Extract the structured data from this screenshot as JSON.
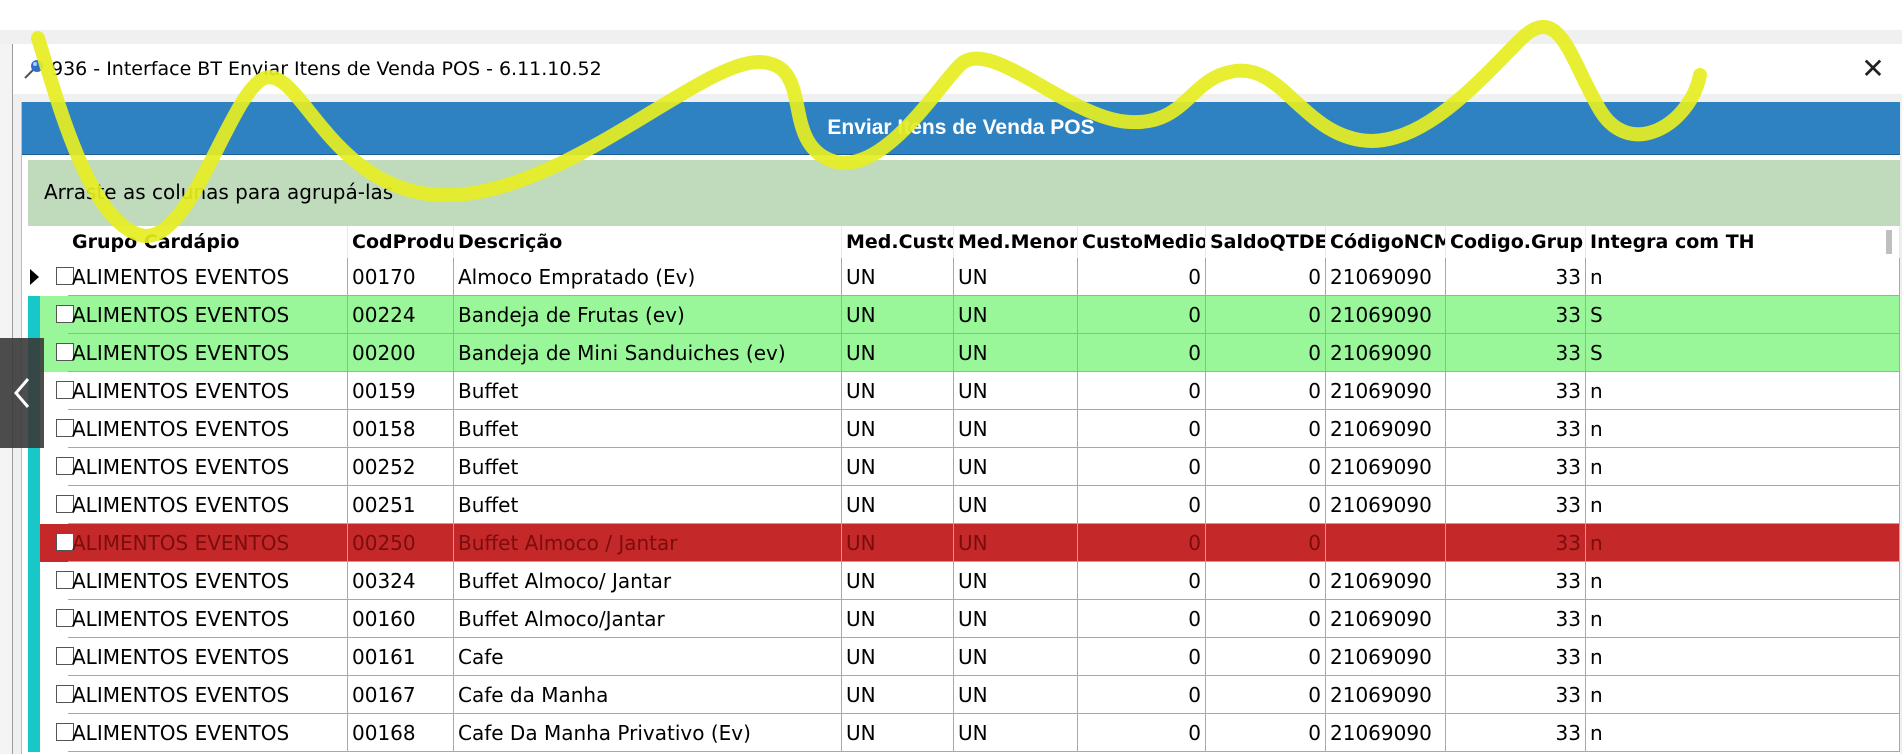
{
  "window": {
    "title": "936 - Interface BT Enviar Itens de Venda POS - 6.11.10.52",
    "close_glyph": "✕"
  },
  "header": {
    "title": "Enviar Itens de Venda POS"
  },
  "group_area": {
    "hint": "Arraste as colunas para agrupá-las"
  },
  "columns": [
    "Grupo Cardápio",
    "CodProduto",
    "Descrição",
    "Med.Custo",
    "Med.Menor",
    "CustoMedio",
    "SaldoQTDE",
    "CódigoNCM",
    "Codigo.Grup",
    "Integra com TH"
  ],
  "rows": [
    {
      "grupo": "ALIMENTOS EVENTOS",
      "cod": "00170",
      "desc": "Almoco Empratado  (Ev)",
      "medcusto": "UN",
      "medmenor": "UN",
      "custo": "0",
      "saldo": "0",
      "ncm": "21069090",
      "codgrup": "33",
      "integra": "n",
      "state": "selected"
    },
    {
      "grupo": "ALIMENTOS EVENTOS",
      "cod": "00224",
      "desc": "Bandeja de Frutas (ev)",
      "medcusto": "UN",
      "medmenor": "UN",
      "custo": "0",
      "saldo": "0",
      "ncm": "21069090",
      "codgrup": "33",
      "integra": "S",
      "state": "green"
    },
    {
      "grupo": "ALIMENTOS EVENTOS",
      "cod": "00200",
      "desc": "Bandeja de Mini Sanduiches (ev)",
      "medcusto": "UN",
      "medmenor": "UN",
      "custo": "0",
      "saldo": "0",
      "ncm": "21069090",
      "codgrup": "33",
      "integra": "S",
      "state": "green"
    },
    {
      "grupo": "ALIMENTOS EVENTOS",
      "cod": "00159",
      "desc": "Buffet",
      "medcusto": "UN",
      "medmenor": "UN",
      "custo": "0",
      "saldo": "0",
      "ncm": "21069090",
      "codgrup": "33",
      "integra": "n",
      "state": "normal"
    },
    {
      "grupo": "ALIMENTOS EVENTOS",
      "cod": "00158",
      "desc": "Buffet",
      "medcusto": "UN",
      "medmenor": "UN",
      "custo": "0",
      "saldo": "0",
      "ncm": "21069090",
      "codgrup": "33",
      "integra": "n",
      "state": "normal"
    },
    {
      "grupo": "ALIMENTOS EVENTOS",
      "cod": "00252",
      "desc": "Buffet",
      "medcusto": "UN",
      "medmenor": "UN",
      "custo": "0",
      "saldo": "0",
      "ncm": "21069090",
      "codgrup": "33",
      "integra": "n",
      "state": "normal"
    },
    {
      "grupo": "ALIMENTOS EVENTOS",
      "cod": "00251",
      "desc": "Buffet",
      "medcusto": "UN",
      "medmenor": "UN",
      "custo": "0",
      "saldo": "0",
      "ncm": "21069090",
      "codgrup": "33",
      "integra": "n",
      "state": "normal"
    },
    {
      "grupo": "ALIMENTOS EVENTOS",
      "cod": "00250",
      "desc": "Buffet Almoco / Jantar",
      "medcusto": "UN",
      "medmenor": "UN",
      "custo": "0",
      "saldo": "0",
      "ncm": "",
      "codgrup": "33",
      "integra": "n",
      "state": "red"
    },
    {
      "grupo": "ALIMENTOS EVENTOS",
      "cod": "00324",
      "desc": "Buffet Almoco/ Jantar",
      "medcusto": "UN",
      "medmenor": "UN",
      "custo": "0",
      "saldo": "0",
      "ncm": "21069090",
      "codgrup": "33",
      "integra": "n",
      "state": "normal"
    },
    {
      "grupo": "ALIMENTOS EVENTOS",
      "cod": "00160",
      "desc": "Buffet Almoco/Jantar",
      "medcusto": "UN",
      "medmenor": "UN",
      "custo": "0",
      "saldo": "0",
      "ncm": "21069090",
      "codgrup": "33",
      "integra": "n",
      "state": "normal"
    },
    {
      "grupo": "ALIMENTOS EVENTOS",
      "cod": "00161",
      "desc": "Cafe",
      "medcusto": "UN",
      "medmenor": "UN",
      "custo": "0",
      "saldo": "0",
      "ncm": "21069090",
      "codgrup": "33",
      "integra": "n",
      "state": "normal"
    },
    {
      "grupo": "ALIMENTOS EVENTOS",
      "cod": "00167",
      "desc": "Cafe da Manha",
      "medcusto": "UN",
      "medmenor": "UN",
      "custo": "0",
      "saldo": "0",
      "ncm": "21069090",
      "codgrup": "33",
      "integra": "n",
      "state": "normal"
    },
    {
      "grupo": "ALIMENTOS EVENTOS",
      "cod": "00168",
      "desc": "Cafe Da Manha Privativo (Ev)",
      "medcusto": "UN",
      "medmenor": "UN",
      "custo": "0",
      "saldo": "0",
      "ncm": "21069090",
      "codgrup": "33",
      "integra": "n",
      "state": "normal"
    }
  ],
  "colors": {
    "header_blue": "#2f82c1",
    "group_green": "#bfdbbc",
    "row_green": "#99f799",
    "row_red": "#c42828",
    "indicator": "#18c8c8",
    "annotation": "#e6ee22"
  },
  "icons": {
    "title": "pin-icon",
    "close": "close-icon",
    "nav": "chevron-left-icon"
  }
}
